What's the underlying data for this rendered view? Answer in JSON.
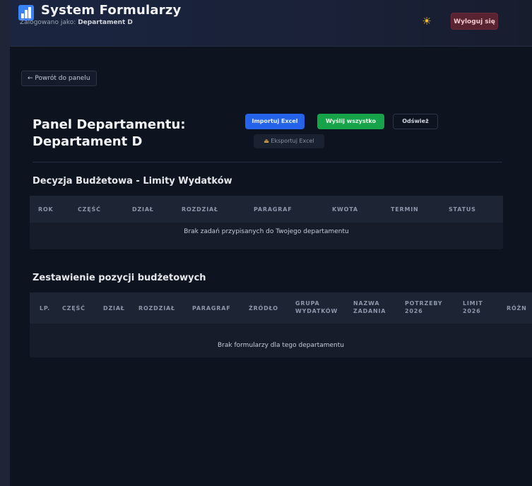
{
  "header": {
    "title": "System Formularzy",
    "login_prefix": "Zalogowano jako:",
    "login_user": "Departament D",
    "theme_icon": "sun-icon",
    "logout_label": "Wyloguj się"
  },
  "nav": {
    "back_label": "← Powrót do panelu"
  },
  "panel": {
    "title_line1": "Panel Departamentu:",
    "title_line2": "Departament D",
    "import_label": "Importuj Excel",
    "send_all_label": "Wyślij wszystko",
    "refresh_label": "Odśwież",
    "export_label": "Eksportuj Excel"
  },
  "budget_limits": {
    "title": "Decyzja Budżetowa - Limity Wydatków",
    "columns": [
      "ROK",
      "CZĘŚĆ",
      "DZIAŁ",
      "ROZDZIAŁ",
      "PARAGRAF",
      "KWOTA",
      "TERMIN",
      "STATUS"
    ],
    "empty_message": "Brak zadań przypisanych do Twojego departamentu"
  },
  "budget_items": {
    "title": "Zestawienie pozycji budżetowych",
    "columns": [
      [
        "LP."
      ],
      [
        "CZĘŚĆ"
      ],
      [
        "DZIAŁ"
      ],
      [
        "ROZDZIAŁ"
      ],
      [
        "PARAGRAF"
      ],
      [
        "ŹRÓDŁO"
      ],
      [
        "GRUPA",
        "WYDATKÓW"
      ],
      [
        "NAZWA",
        "ZADANIA"
      ],
      [
        "POTRZEBY",
        "2026"
      ],
      [
        "LIMIT",
        "2026"
      ],
      [
        "RÓŻN"
      ]
    ],
    "empty_message": "Brak formularzy dla tego departamentu"
  },
  "colors": {
    "accent_blue": "#2563eb",
    "accent_green": "#16a34a",
    "logout_bg": "#5a2331",
    "background": "#0e1320"
  }
}
